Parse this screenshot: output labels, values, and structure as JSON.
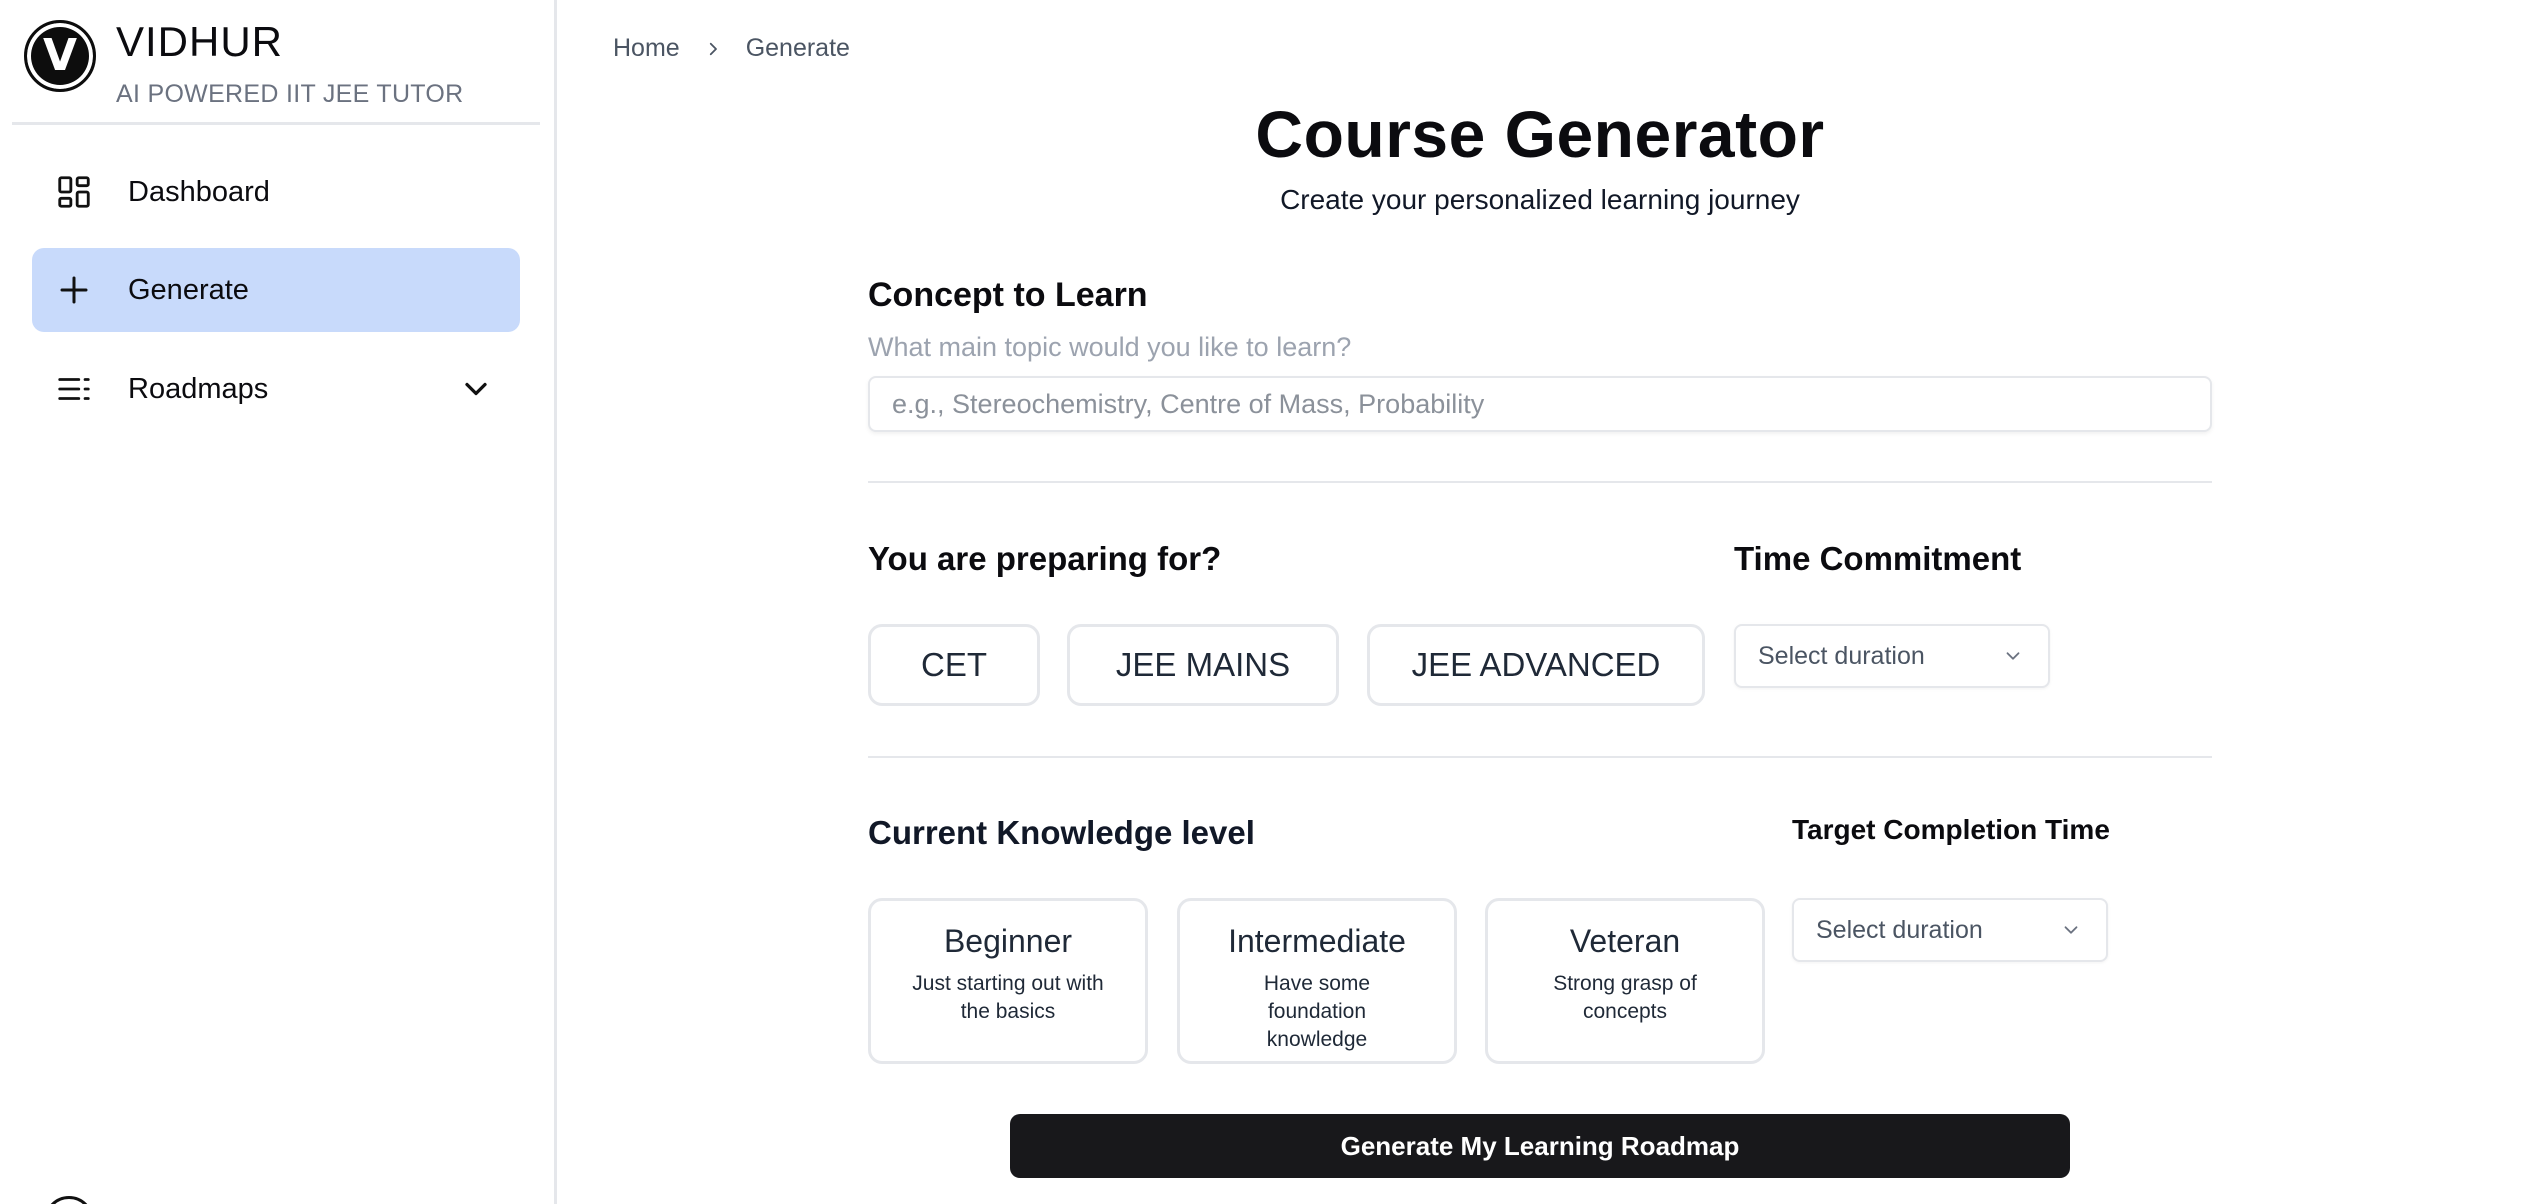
{
  "brand": {
    "logo_letter": "V",
    "name": "VIDHUR",
    "subtitle": "AI POWERED IIT JEE TUTOR"
  },
  "sidebar": {
    "items": [
      {
        "label": "Dashboard",
        "icon": "dashboard-grid-icon",
        "active": false
      },
      {
        "label": "Generate",
        "icon": "plus-icon",
        "active": true
      },
      {
        "label": "Roadmaps",
        "icon": "list-icon",
        "active": false,
        "expandable": true
      }
    ]
  },
  "breadcrumb": {
    "home": "Home",
    "current": "Generate"
  },
  "page": {
    "title": "Course Generator",
    "subtitle": "Create your personalized learning journey"
  },
  "concept": {
    "heading": "Concept to Learn",
    "hint": "What main topic would you like to learn?",
    "value": "",
    "placeholder": "e.g., Stereochemistry, Centre of Mass, Probability"
  },
  "preparing": {
    "heading": "You are preparing for?",
    "options": [
      "CET",
      "JEE MAINS",
      "JEE ADVANCED"
    ]
  },
  "time_commitment": {
    "heading": "Time Commitment",
    "selected": "Select duration"
  },
  "knowledge": {
    "heading": "Current Knowledge level",
    "levels": [
      {
        "title": "Beginner",
        "desc": "Just starting out with the basics"
      },
      {
        "title": "Intermediate",
        "desc": "Have some foundation knowledge"
      },
      {
        "title": "Veteran",
        "desc": "Strong grasp of concepts"
      }
    ]
  },
  "target_completion": {
    "heading": "Target Completion Time",
    "selected": "Select duration"
  },
  "actions": {
    "generate_label": "Generate My Learning Roadmap"
  },
  "colors": {
    "active_nav_bg": "#c8dafb",
    "primary_button": "#18181b",
    "border": "#e5e7eb"
  }
}
